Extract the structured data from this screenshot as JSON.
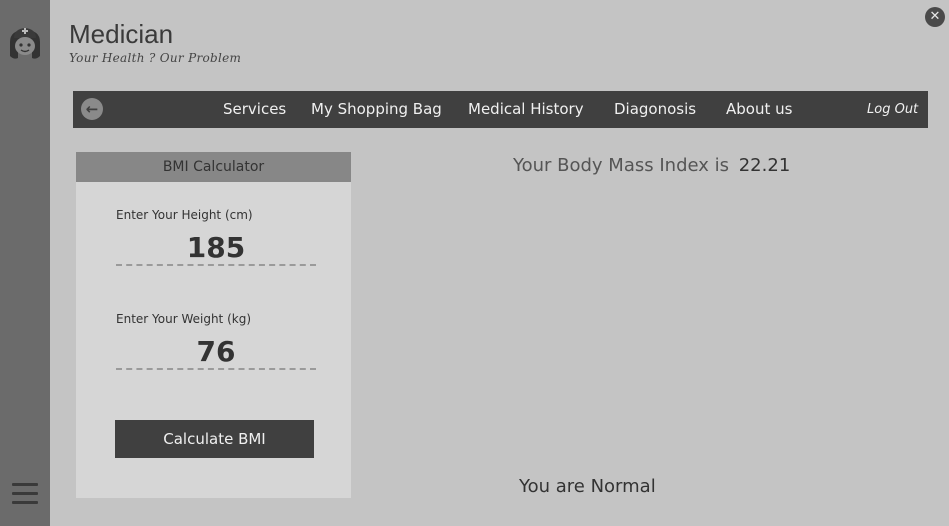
{
  "app": {
    "title": "Medician",
    "tagline": "Your Health ? Our Problem"
  },
  "nav": {
    "items": [
      "Services",
      "My Shopping Bag",
      "Medical History",
      "Diagonosis",
      "About us"
    ],
    "logout": "Log Out"
  },
  "bmi_calculator": {
    "header": "BMI Calculator",
    "height_label": "Enter Your Height (cm)",
    "height_value": "185",
    "weight_label": "Enter Your Weight (kg)",
    "weight_value": "76",
    "button_label": "Calculate BMI"
  },
  "result": {
    "prefix": "Your Body Mass Index is",
    "bmi": "22.21",
    "status": "You are Normal"
  },
  "icons": {
    "logo": "nurse-icon",
    "menu": "hamburger-icon",
    "back": "arrow-left-icon",
    "close": "close-icon"
  },
  "colors": {
    "background": "#c4c4c4",
    "sidebar": "#6b6b6b",
    "navbar": "#404040",
    "panel": "#d6d6d6",
    "panel_header": "#878787"
  }
}
